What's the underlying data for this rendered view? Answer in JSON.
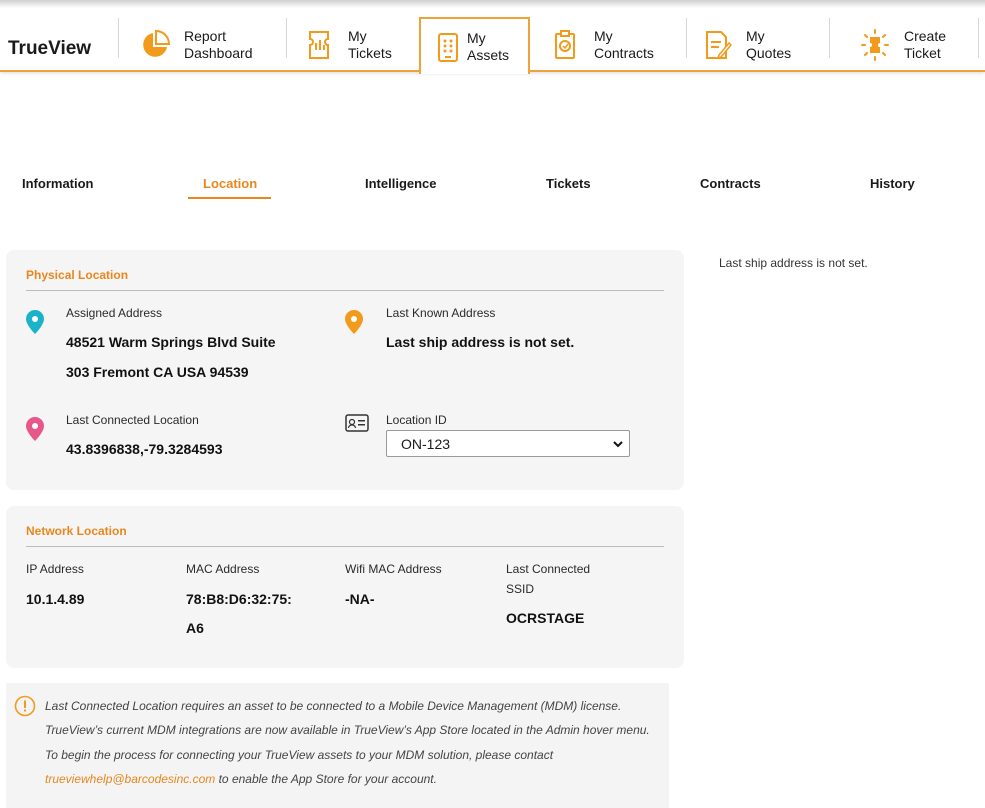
{
  "brand": "TrueView",
  "nav": [
    {
      "icon": "pie-chart-icon",
      "line1": "Report",
      "line2": "Dashboard"
    },
    {
      "icon": "ticket-icon",
      "line1": "My",
      "line2": "Tickets"
    },
    {
      "icon": "device-icon",
      "line1": "My",
      "line2": "Assets"
    },
    {
      "icon": "contract-clipboard-icon",
      "line1": "My",
      "line2": "Contracts"
    },
    {
      "icon": "quote-document-icon",
      "line1": "My",
      "line2": "Quotes"
    },
    {
      "icon": "create-ticket-icon",
      "line1": "Create",
      "line2": "Ticket"
    }
  ],
  "active_nav": "My Assets",
  "tabs": [
    "Information",
    "Location",
    "Intelligence",
    "Tickets",
    "Contracts",
    "History"
  ],
  "active_tab": "Location",
  "physical": {
    "title": "Physical Location",
    "assigned_label": "Assigned Address",
    "assigned_line1": "48521 Warm Springs Blvd Suite",
    "assigned_line2": "303 Fremont CA USA 94539",
    "last_known_label": "Last Known Address",
    "last_known_value": "Last ship address is not set.",
    "last_connected_label": "Last Connected Location",
    "last_connected_value": "43.8396838,-79.3284593",
    "location_id_label": "Location ID",
    "location_id_value": "ON-123"
  },
  "network": {
    "title": "Network Location",
    "ip_label": "IP Address",
    "ip_value": "10.1.4.89",
    "mac_label": "MAC Address",
    "mac_line1": "78:B8:D6:32:75:",
    "mac_line2": "A6",
    "wifi_label": "Wifi MAC Address",
    "wifi_value": "-NA-",
    "ssid_label_line1": "Last Connected",
    "ssid_label_line2": "SSID",
    "ssid_value": "OCRSTAGE"
  },
  "side_note": "Last ship address is not set.",
  "info": {
    "text_before": "Last Connected Location requires an asset to be connected to a Mobile Device Management (MDM) license. TrueView’s current MDM integrations are now available in TrueView’s App Store located in the Admin hover menu. To begin the process for connecting your TrueView assets to your MDM solution, please contact ",
    "email": "trueviewhelp@barcodesinc.com",
    "text_after": " to enable the App Store for your account."
  },
  "colors": {
    "accent": "#e8871e",
    "pin_teal": "#1bb3c9",
    "pin_orange": "#f29a1b",
    "pin_pink": "#e8578a"
  }
}
